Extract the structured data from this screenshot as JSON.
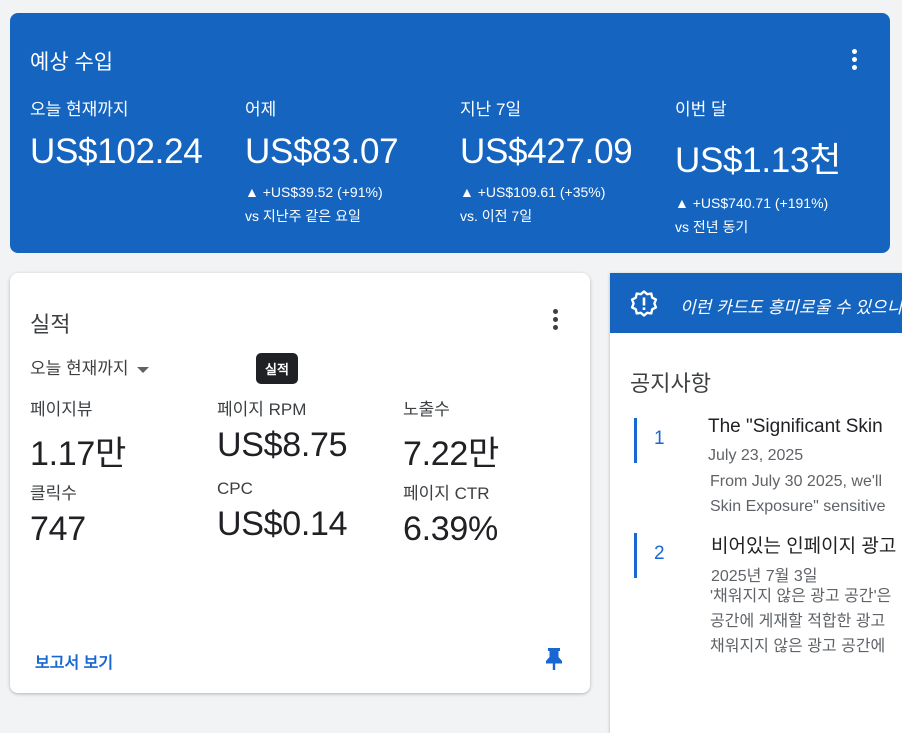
{
  "earnings": {
    "title": "예상 수입",
    "metrics": [
      {
        "label": "오늘 현재까지",
        "value": "US$102.24",
        "change": "",
        "compare": ""
      },
      {
        "label": "어제",
        "value": "US$83.07",
        "change": "▲ +US$39.52 (+91%)",
        "compare": "vs 지난주 같은 요일"
      },
      {
        "label": "지난 7일",
        "value": "US$427.09",
        "change": "▲ +US$109.61 (+35%)",
        "compare": "vs. 이전 7일"
      },
      {
        "label": "이번 달",
        "value": "US$1.13천",
        "change": "▲ +US$740.71 (+191%)",
        "compare": "vs 전년 동기"
      }
    ]
  },
  "performance": {
    "title": "실적",
    "range": "오늘 현재까지",
    "tooltip": "실적",
    "stats": [
      {
        "label": "페이지뷰",
        "value": "1.17만"
      },
      {
        "label": "페이지 RPM",
        "value": "US$8.75"
      },
      {
        "label": "노출수",
        "value": "7.22만"
      },
      {
        "label": "클릭수",
        "value": "747"
      },
      {
        "label": "CPC",
        "value": "US$0.14"
      },
      {
        "label": "페이지 CTR",
        "value": "6.39%"
      }
    ],
    "report_link": "보고서 보기"
  },
  "promo": {
    "text": "이런 카드도 흥미로울 수 있으니"
  },
  "notices": {
    "title": "공지사항",
    "items": [
      {
        "number": "1",
        "title": "The \"Significant Skin",
        "date": "July 23, 2025",
        "body": [
          "From July 30 2025, we'll",
          "Skin Exposure\" sensitive"
        ]
      },
      {
        "number": "2",
        "title": "비어있는 인페이지 광고",
        "date": "2025년 7월 3일",
        "body": [
          "'채워지지 않은 광고 공간'은",
          "공간에 게재할 적합한 광고",
          "채워지지 않은 광고 공간에"
        ]
      }
    ]
  },
  "colors": {
    "primary": "#1565c0",
    "link": "#1967d2",
    "background": "#f1f3f4"
  }
}
